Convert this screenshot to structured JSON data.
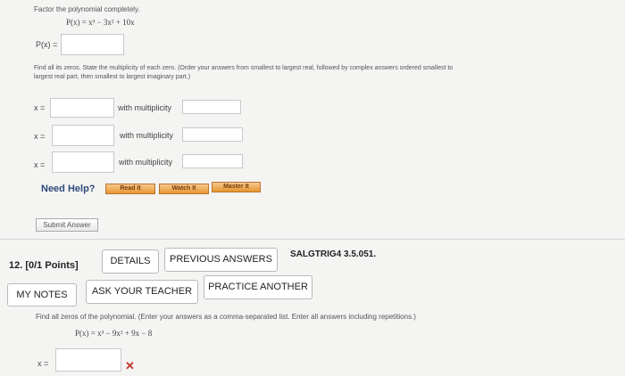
{
  "problem11": {
    "instruction": "Factor the polynomial completely.",
    "polynomial": "P(x) = x³ − 3x² + 10x",
    "answer_label": "P(x) =",
    "zeros_instruction_1": "Find all its zeros. State the multiplicity of each zero. (Order your answers from smallest to largest real, followed by complex answers ordered smallest to",
    "zeros_instruction_2": "largest real part, then smallest to largest imaginary part.)",
    "zero_rows": [
      {
        "x_label": "x =",
        "mult_label": "with multiplicity"
      },
      {
        "x_label": "x =",
        "mult_label": "with multiplicity"
      },
      {
        "x_label": "x =",
        "mult_label": "with multiplicity"
      }
    ],
    "need_help_label": "Need Help?",
    "help_buttons": [
      "Read It",
      "Watch It",
      "Master It"
    ],
    "submit_label": "Submit Answer"
  },
  "problem12": {
    "header": "12. [0/1 Points]",
    "details_label": "DETAILS",
    "previous_answers_label": "PREVIOUS ANSWERS",
    "code": "SALGTRIG4 3.5.051.",
    "my_notes_label": "MY NOTES",
    "ask_teacher_label": "ASK YOUR TEACHER",
    "practice_another_label": "PRACTICE ANOTHER",
    "instruction": "Find all zeros of the polynomial. (Enter your answers as a comma-separated list. Enter all answers including repetitions.)",
    "polynomial": "P(x) = x³ − 9x² + 9x − 8",
    "x_label": "x =",
    "status_mark": "✕",
    "status_color": "#c0392b"
  }
}
